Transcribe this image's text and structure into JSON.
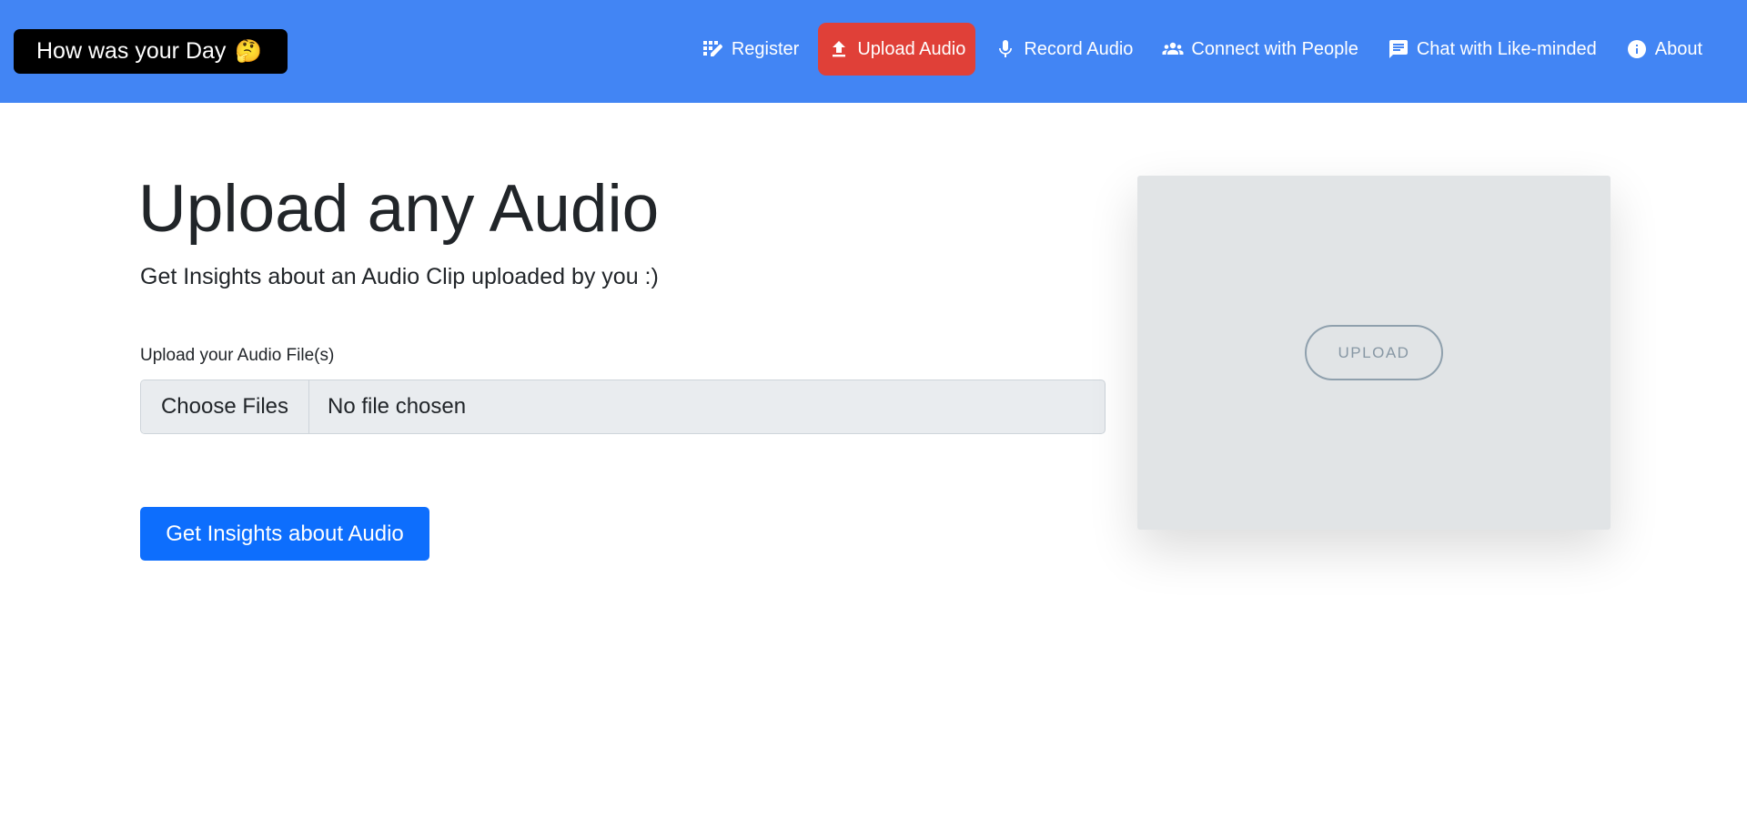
{
  "navbar": {
    "brand": {
      "label": "How was your Day",
      "emoji": "🤔"
    },
    "items": [
      {
        "label": "Register",
        "icon": "register-icon",
        "active": false
      },
      {
        "label": "Upload Audio",
        "icon": "upload-icon",
        "active": true
      },
      {
        "label": "Record Audio",
        "icon": "microphone-icon",
        "active": false
      },
      {
        "label": "Connect with People",
        "icon": "people-icon",
        "active": false
      },
      {
        "label": "Chat with Like-minded",
        "icon": "chat-icon",
        "active": false
      },
      {
        "label": "About",
        "icon": "info-icon",
        "active": false
      }
    ],
    "colors": {
      "background": "#4285f4",
      "active": "#e04038"
    }
  },
  "main": {
    "title": "Upload any Audio",
    "subtitle": "Get Insights about an Audio Clip uploaded by you :)",
    "file_field": {
      "label": "Upload your Audio File(s)",
      "button_label": "Choose Files",
      "status": "No file chosen"
    },
    "submit_label": "Get Insights about Audio",
    "colors": {
      "primary": "#0d6efd"
    }
  },
  "upload_panel": {
    "button_label": "UPLOAD"
  }
}
